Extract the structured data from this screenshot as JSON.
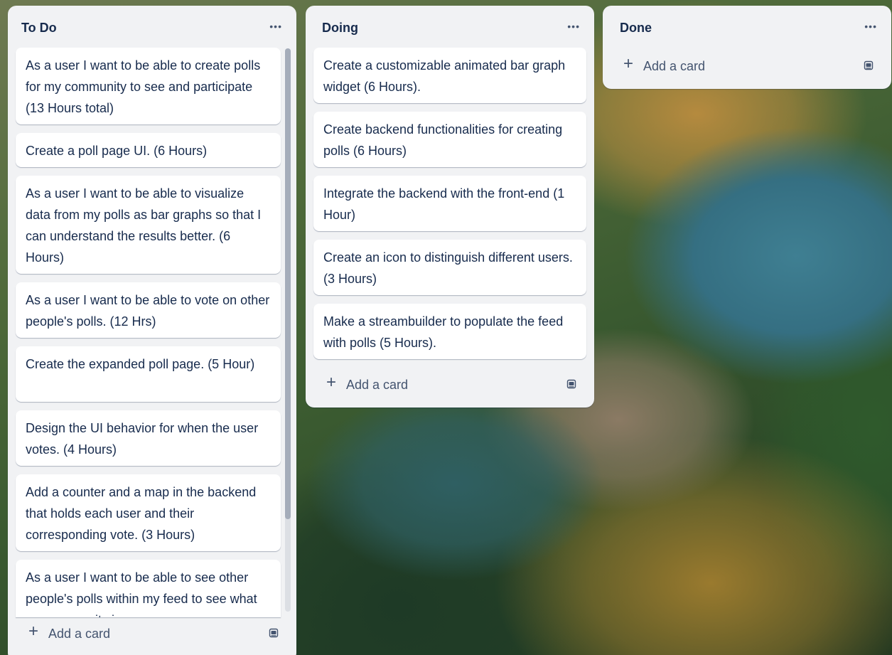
{
  "board": {
    "lists": [
      {
        "title": "To Do",
        "menu_icon": "ellipsis-icon",
        "cards": [
          "As a user I want to be able to create polls for my community to see and participate (13 Hours total)",
          "Create a poll page UI. (6 Hours)",
          "As a user I want to be able to visualize data from my polls as bar graphs so that I can understand the results better. (6 Hours)",
          "As a user I want to be able to vote on other people's polls. (12 Hrs)",
          "Create the expanded poll page. (5 Hour)",
          "Design the UI behavior for when the user votes. (4 Hours)",
          "Add a counter and a map in the backend that holds each user and their corresponding vote. (3 Hours)",
          "As a user I want to be able to see other people's polls within my feed to see what my community is"
        ],
        "add_card_label": "Add a card"
      },
      {
        "title": "Doing",
        "menu_icon": "ellipsis-icon",
        "cards": [
          "Create a customizable animated bar graph widget (6 Hours).",
          "Create backend functionalities for creating polls (6 Hours)",
          "Integrate the backend with the front-end (1 Hour)",
          "Create an icon to distinguish different users. (3 Hours)",
          "Make a streambuilder to populate the feed with polls (5 Hours)."
        ],
        "add_card_label": "Add a card"
      },
      {
        "title": "Done",
        "menu_icon": "ellipsis-icon",
        "cards": [],
        "add_card_label": "Add a card"
      }
    ]
  },
  "colors": {
    "list_background": "#f1f2f4",
    "card_background": "#ffffff",
    "text_primary": "#172b4d",
    "text_secondary": "#44546f"
  }
}
